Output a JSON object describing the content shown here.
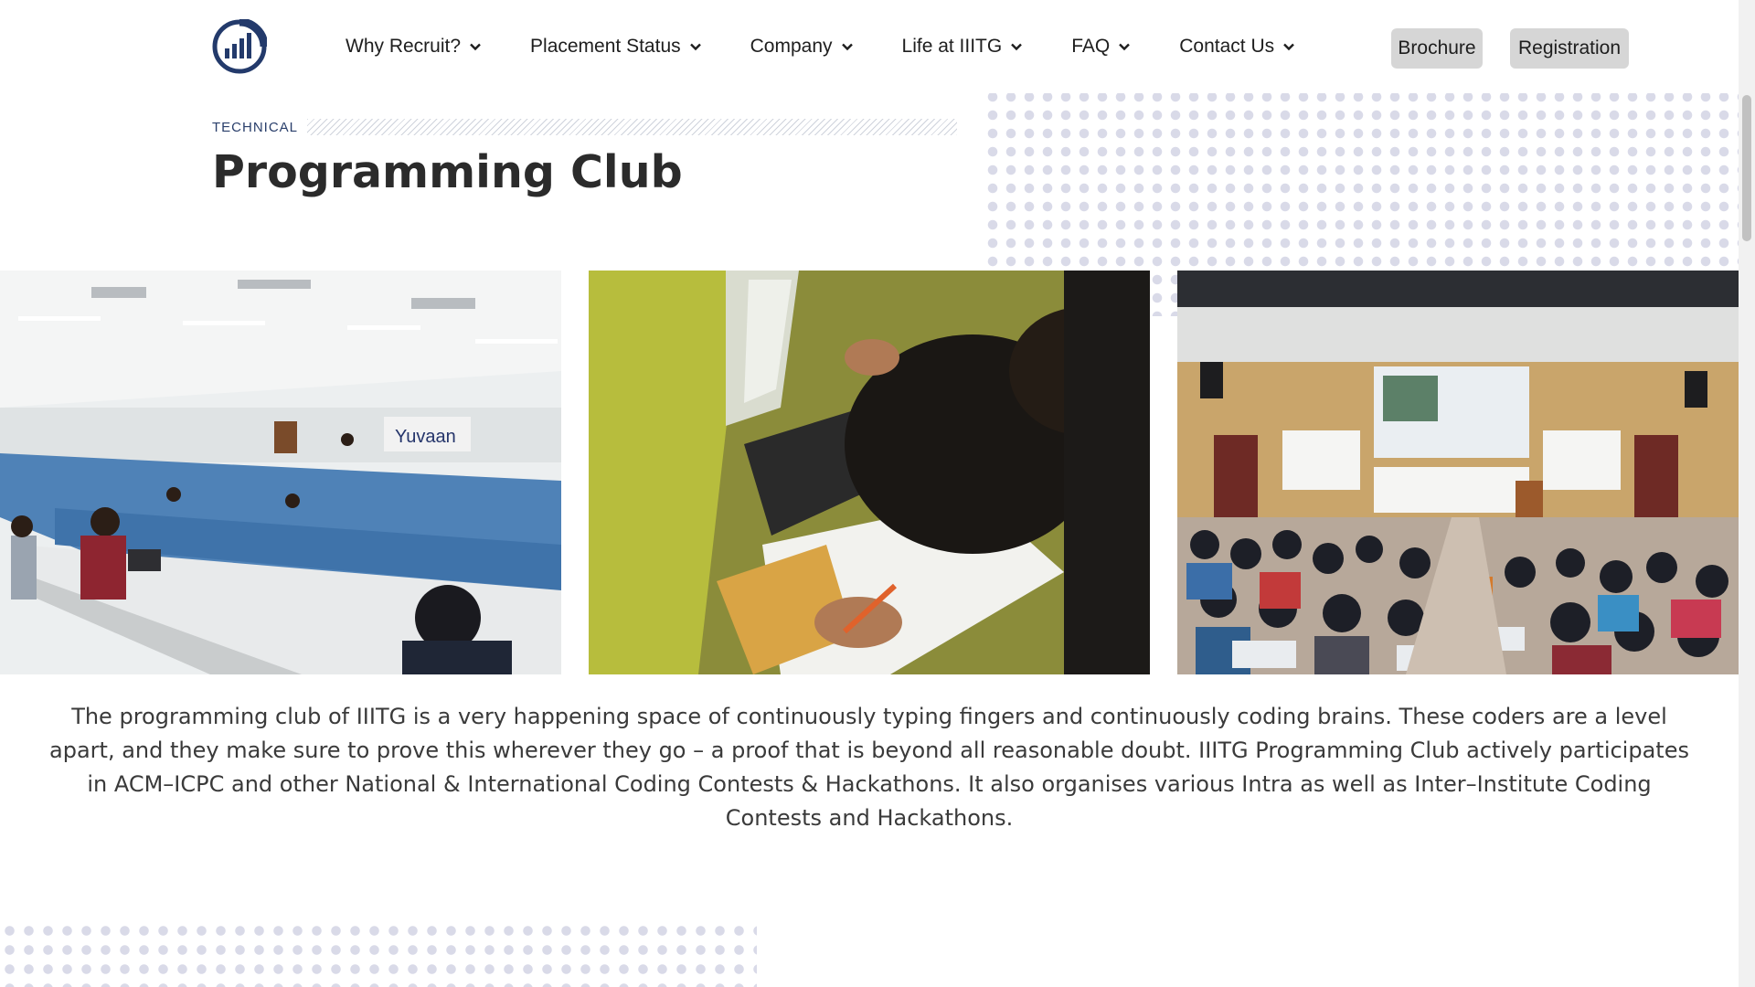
{
  "header": {
    "logo_icon": "bar-chart-circle-icon",
    "nav": [
      {
        "label": "Why Recruit?"
      },
      {
        "label": "Placement Status"
      },
      {
        "label": "Company"
      },
      {
        "label": "Life at IIITG"
      },
      {
        "label": "FAQ"
      },
      {
        "label": "Contact Us"
      }
    ],
    "brochure_label": "Brochure",
    "registration_label": "Registration"
  },
  "section": {
    "eyebrow": "TECHNICAL",
    "title": "Programming Club"
  },
  "photos": [
    {
      "alt": "Students coding in a computer lab"
    },
    {
      "alt": "Student writing on paper beside a keyboard"
    },
    {
      "alt": "Students attending a lecture in an auditorium"
    }
  ],
  "description": "The programming club of IIITG is a very happening space of continuously typing fingers and continuously coding brains. These coders are a level apart, and they make sure to prove this wherever they go – a proof that is beyond all reasonable doubt. IIITG Programming Club actively participates in ACM–ICPC and other National & International Coding Contests & Hackathons. It also organises various Intra as well as Inter–Institute Coding Contests and Hackathons.",
  "colors": {
    "brand_navy": "#233a6b",
    "button_grey": "#d6d6d6",
    "dot_pattern": "#d9dae8"
  }
}
